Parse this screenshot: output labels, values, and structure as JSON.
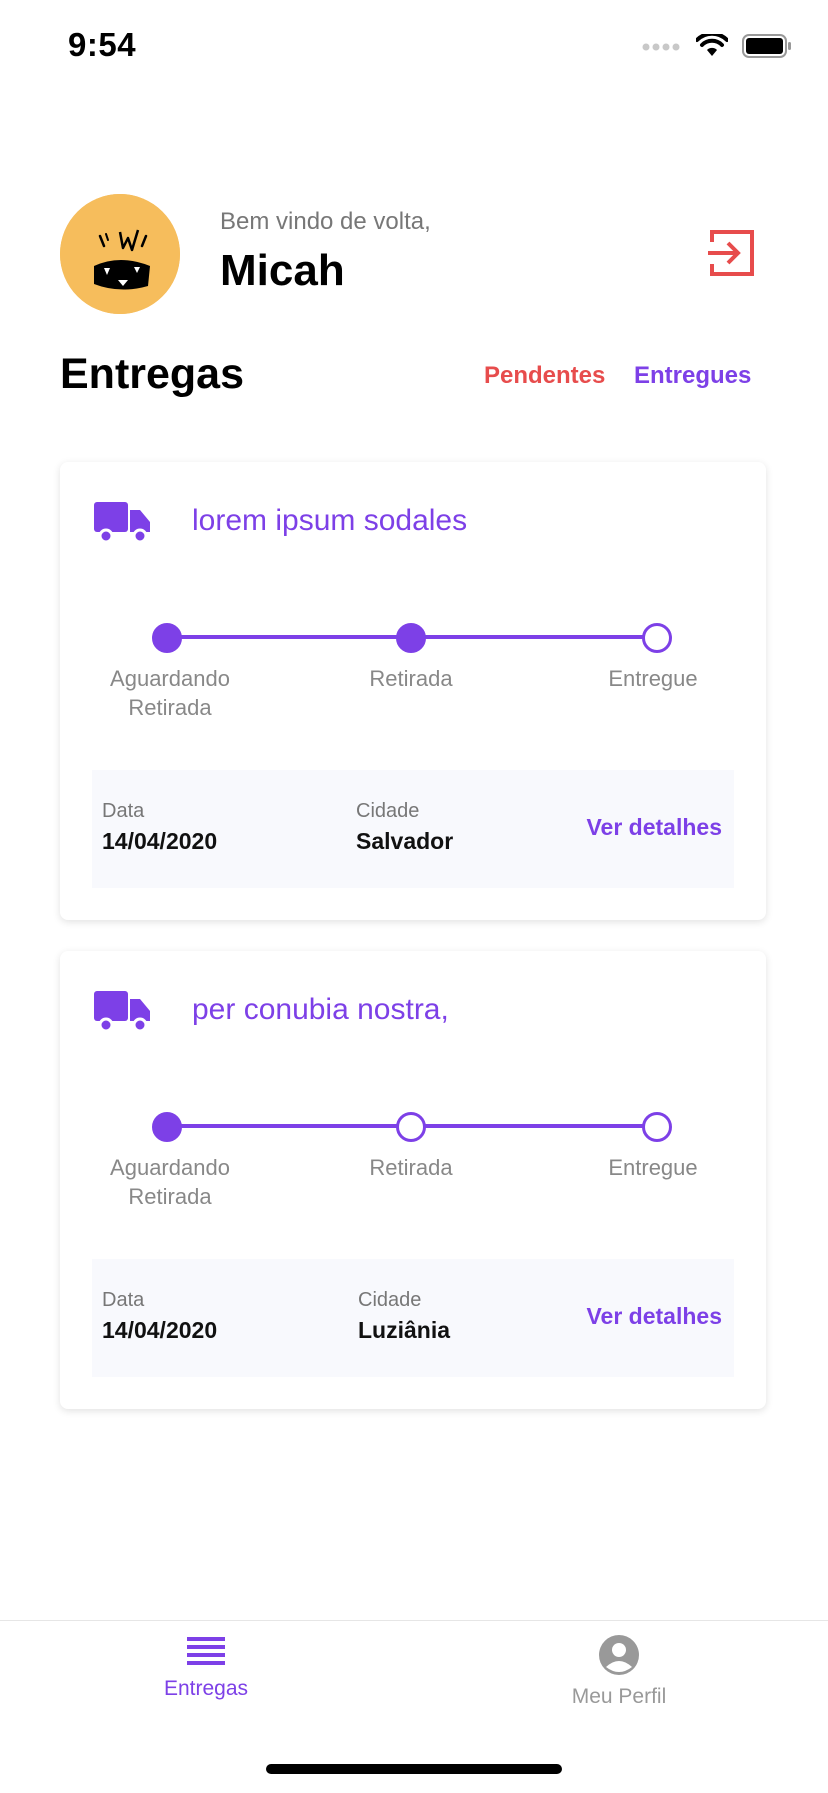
{
  "status_bar": {
    "time": "9:54"
  },
  "header": {
    "welcome_text": "Bem vindo de volta,",
    "user_name": "Micah",
    "avatar_color": "#f6bd5c",
    "logout_icon": "logout-icon",
    "logout_color": "#e74c4c"
  },
  "section": {
    "title": "Entregas",
    "filters": [
      {
        "label": "Pendentes",
        "color": "#e74c4c"
      },
      {
        "label": "Entregues",
        "color": "#7d40e7"
      }
    ]
  },
  "deliveries": [
    {
      "product": "lorem ipsum sodales",
      "steps": [
        {
          "label": "Aguardando Retirada",
          "done": true
        },
        {
          "label": "Retirada",
          "done": true
        },
        {
          "label": "Entregue",
          "done": false
        }
      ],
      "date_label": "Data",
      "date": "14/04/2020",
      "city_label": "Cidade",
      "city": "Salvador",
      "details_label": "Ver detalhes"
    },
    {
      "product": "per conubia nostra,",
      "steps": [
        {
          "label": "Aguardando Retirada",
          "done": true
        },
        {
          "label": "Retirada",
          "done": false
        },
        {
          "label": "Entregue",
          "done": false
        }
      ],
      "date_label": "Data",
      "date": "14/04/2020",
      "city_label": "Cidade",
      "city": "Luziânia",
      "details_label": "Ver detalhes"
    }
  ],
  "tab_bar": {
    "tabs": [
      {
        "label": "Entregas",
        "icon": "list-icon",
        "active": true
      },
      {
        "label": "Meu Perfil",
        "icon": "profile-icon",
        "active": false
      }
    ]
  },
  "colors": {
    "accent": "#7d40e7",
    "danger": "#e74c4c",
    "inactive": "#999999"
  }
}
